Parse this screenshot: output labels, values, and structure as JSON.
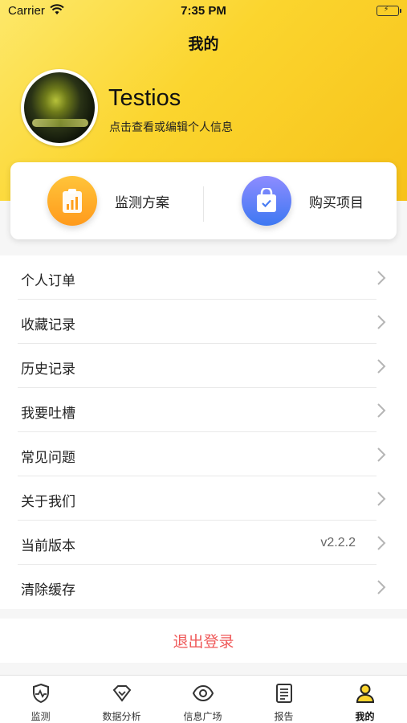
{
  "status_bar": {
    "carrier": "Carrier",
    "time": "7:35 PM"
  },
  "header": {
    "title": "我的"
  },
  "profile": {
    "username": "Testios",
    "subtitle": "点击查看或编辑个人信息"
  },
  "actions": [
    {
      "label": "监测方案",
      "icon": "chart-clipboard-icon",
      "color": "#ff9f1c"
    },
    {
      "label": "购买项目",
      "icon": "shopping-bag-icon",
      "color": "#4a7df3"
    }
  ],
  "menu": [
    {
      "label": "个人订单",
      "value": ""
    },
    {
      "label": "收藏记录",
      "value": ""
    },
    {
      "label": "历史记录",
      "value": ""
    },
    {
      "label": "我要吐槽",
      "value": ""
    },
    {
      "label": "常见问题",
      "value": ""
    },
    {
      "label": "关于我们",
      "value": ""
    },
    {
      "label": "当前版本",
      "value": "v2.2.2"
    },
    {
      "label": "清除缓存",
      "value": ""
    }
  ],
  "logout_label": "退出登录",
  "tabs": [
    {
      "label": "监测",
      "icon": "shield-pulse-icon"
    },
    {
      "label": "数据分析",
      "icon": "diamond-icon"
    },
    {
      "label": "信息广场",
      "icon": "eye-icon"
    },
    {
      "label": "报告",
      "icon": "document-icon"
    },
    {
      "label": "我的",
      "icon": "person-icon",
      "active": true
    }
  ],
  "colors": {
    "accent": "#fbd52e",
    "logout": "#ef5a5a",
    "battery": "#4cd964"
  }
}
